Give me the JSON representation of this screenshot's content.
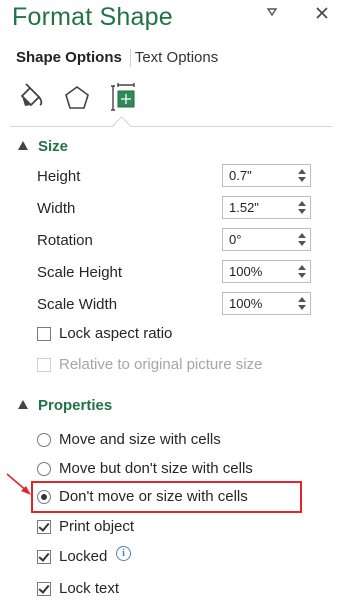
{
  "header": {
    "title": "Format Shape",
    "pin_icon": "pin-icon",
    "close_icon": "close-icon"
  },
  "tabs": {
    "shape_options": "Shape Options",
    "text_options": "Text Options"
  },
  "icons": [
    "fill-line-icon",
    "effects-icon",
    "size-properties-icon"
  ],
  "size": {
    "heading": "Size",
    "height_label": "Height",
    "height_value": "0.7\"",
    "width_label": "Width",
    "width_value": "1.52\"",
    "rotation_label": "Rotation",
    "rotation_value": "0°",
    "scale_height_label": "Scale Height",
    "scale_height_value": "100%",
    "scale_width_label": "Scale Width",
    "scale_width_value": "100%",
    "lock_aspect_label": "Lock aspect ratio",
    "relative_label": "Relative to original picture size"
  },
  "properties": {
    "heading": "Properties",
    "move_size_label": "Move and size with cells",
    "move_no_size_label": "Move but don't size with cells",
    "dont_move_label": "Don't move or size with cells",
    "print_object_label": "Print object",
    "locked_label": "Locked",
    "lock_text_label": "Lock text"
  },
  "colors": {
    "accent": "#217346",
    "highlight": "#e0262b"
  }
}
